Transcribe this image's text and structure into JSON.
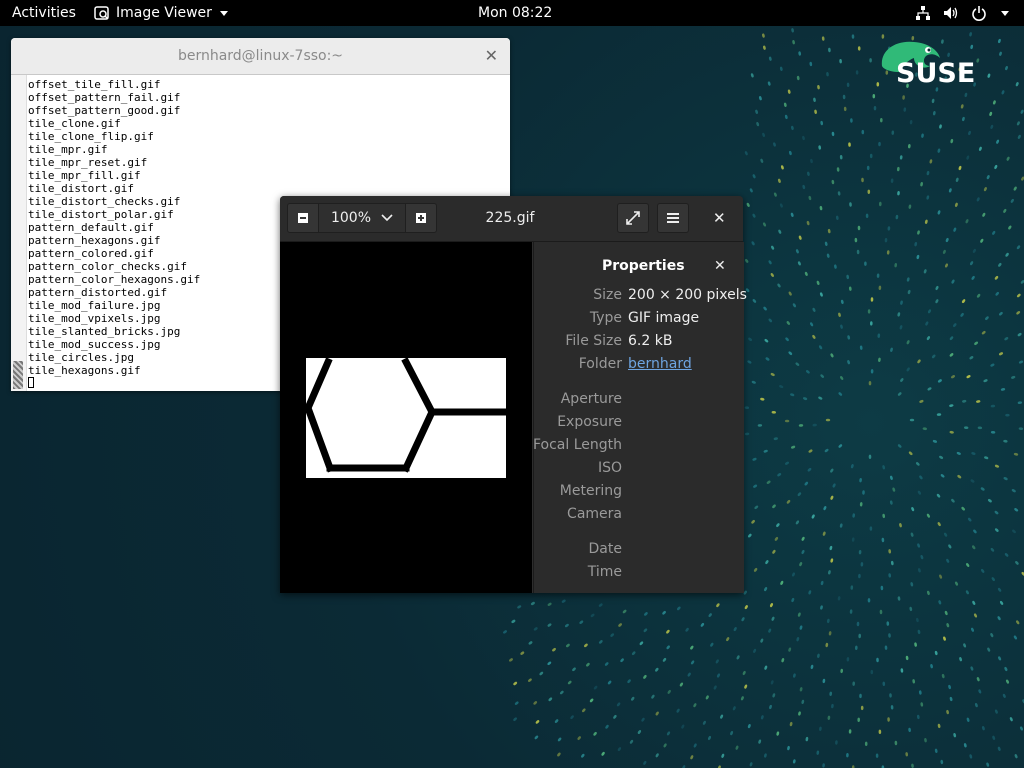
{
  "topbar": {
    "activities": "Activities",
    "app_name": "Image Viewer",
    "clock": "Mon 08:22",
    "tray": [
      "network-icon",
      "volume-icon",
      "power-icon"
    ]
  },
  "desktop": {
    "logo_text": "SUSE",
    "colors": {
      "background": "#0b2a35",
      "logo_green": "#30ba78"
    }
  },
  "terminal": {
    "title": "bernhard@linux-7sso:~",
    "lines": [
      "offset_tile_fill.gif",
      "offset_pattern_fail.gif",
      "offset_pattern_good.gif",
      "tile_clone.gif",
      "tile_clone_flip.gif",
      "tile_mpr.gif",
      "tile_mpr_reset.gif",
      "tile_mpr_fill.gif",
      "tile_distort.gif",
      "tile_distort_checks.gif",
      "tile_distort_polar.gif",
      "pattern_default.gif",
      "pattern_hexagons.gif",
      "pattern_colored.gif",
      "pattern_color_checks.gif",
      "pattern_color_hexagons.gif",
      "pattern_distorted.gif",
      "tile_mod_failure.jpg",
      "tile_mod_vpixels.jpg",
      "tile_slanted_bricks.jpg",
      "tile_mod_success.jpg",
      "tile_circles.jpg",
      "tile_hexagons.gif"
    ]
  },
  "viewer": {
    "zoom": "100%",
    "title": "225.gif",
    "properties": {
      "heading": "Properties",
      "rows": [
        {
          "label": "Size",
          "value": "200 × 200 pixels"
        },
        {
          "label": "Type",
          "value": "GIF image"
        },
        {
          "label": "File Size",
          "value": "6.2 kB"
        },
        {
          "label": "Folder",
          "value": "bernhard"
        }
      ],
      "exif_labels": [
        "Aperture",
        "Exposure",
        "Focal Length",
        "ISO",
        "Metering",
        "Camera"
      ],
      "date_labels": [
        "Date",
        "Time"
      ]
    }
  }
}
